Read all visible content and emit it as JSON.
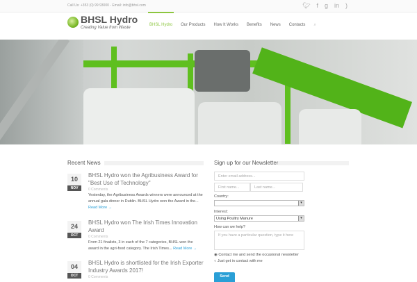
{
  "topbar": {
    "contact": "Call Us: +353 (0) 99 93000 - Email: info@bhsl.com",
    "social": [
      "twitter-icon",
      "facebook-icon",
      "google-plus-icon",
      "linkedin-icon",
      "rss-icon"
    ]
  },
  "logo": {
    "title": "BHSL Hydro",
    "tagline": "Creating Value from Waste"
  },
  "nav": [
    "BHSL Hydro",
    "Our Products",
    "How It Works",
    "Benefits",
    "News",
    "Contacts"
  ],
  "news": {
    "title": "Recent News",
    "items": [
      {
        "day": "10",
        "month": "NOV",
        "title": "BHSL Hydro won the Agribusiness Award for \"Best Use of Technology\"",
        "comments": "0 Comments",
        "excerpt": "Yesterday, the Agribusiness Awards winners were announced at the annual gala dinner in Dublin. BHSL Hydro won the Award in the...",
        "more": "Read More →"
      },
      {
        "day": "24",
        "month": "OCT",
        "title": "BHSL Hydro won The Irish Times Innovation Award",
        "comments": "0 Comments",
        "excerpt": "From 21 finalists, 3 in each of the 7 categories, BHSL won the award in the agri-food category. The Irish Times...",
        "more": "Read More →"
      },
      {
        "day": "04",
        "month": "OCT",
        "title": "BHSL Hydro is shortlisted for the Irish Exporter Industry Awards 2017!",
        "comments": "0 Comments"
      }
    ]
  },
  "newsletter": {
    "title": "Sign up for our Newsletter",
    "email_placeholder": "Enter email address...",
    "first_placeholder": "First name...",
    "last_placeholder": "Last name...",
    "country_label": "Country:",
    "country_value": "",
    "interest_label": "Interest:",
    "interest_value": "Using Poultry Manure",
    "help_label": "How can we help?",
    "help_placeholder": "If you have a particular question, type it here",
    "radio1": "Contact me and send the occasional newsletter",
    "radio2": "Just get in contact with me",
    "send": "Send"
  },
  "colors": {
    "accent": "#8cc63f",
    "link": "#2a9fd6"
  }
}
